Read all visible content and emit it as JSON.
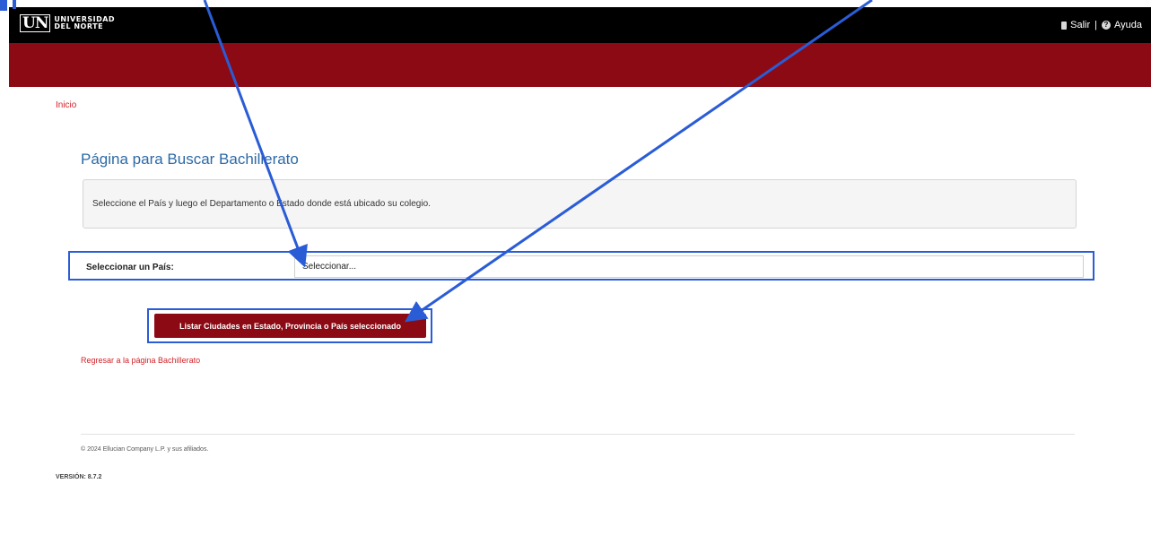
{
  "header": {
    "logo_mark": "UN",
    "logo_line1": "UNIVERSIDAD",
    "logo_line2": "DEL  NORTE",
    "logout_label": "Salir",
    "separator": "|",
    "help_label": "Ayuda"
  },
  "breadcrumb": {
    "home_label": "Inicio"
  },
  "page": {
    "title": "Página para Buscar Bachillerato",
    "instructions": "Seleccione el País y luego el Departamento o Estado donde está ubicado su colegio."
  },
  "form": {
    "country_label": "Seleccionar un País:",
    "country_select_value": "Seleccionar...",
    "list_button_label": "Listar Ciudades en Estado, Provincia o País seleccionado"
  },
  "links": {
    "return_label": "Regresar a la página Bachillerato"
  },
  "footer": {
    "copyright": "© 2024 Ellucian Company L.P. y sus afiliados.",
    "version": "VERSIÓN: 8.7.2"
  },
  "colors": {
    "topbar": "#000000",
    "brand_red": "#8b0a14",
    "link_red": "#d2232a",
    "title_blue": "#2c6aa6",
    "annotation_blue": "#2a5cd6"
  }
}
